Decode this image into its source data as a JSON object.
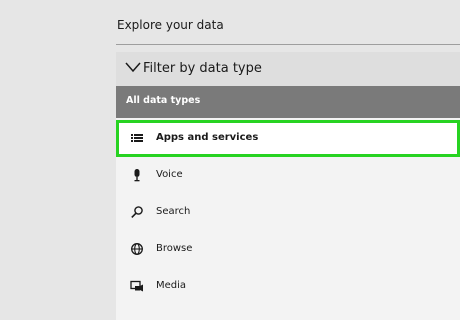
{
  "panel": {
    "title": "Explore your data"
  },
  "filter": {
    "header_label": "Filter by data type",
    "icon": "chevron-down-icon",
    "all_label": "All data types"
  },
  "items": [
    {
      "label": "Apps and services",
      "icon": "apps-list-icon",
      "selected": true
    },
    {
      "label": "Voice",
      "icon": "microphone-icon",
      "selected": false
    },
    {
      "label": "Search",
      "icon": "search-icon",
      "selected": false
    },
    {
      "label": "Browse",
      "icon": "globe-icon",
      "selected": false
    },
    {
      "label": "Media",
      "icon": "media-icon",
      "selected": false
    }
  ],
  "colors": {
    "highlight": "#27d321",
    "all_types_bg": "#7a7a7a"
  }
}
